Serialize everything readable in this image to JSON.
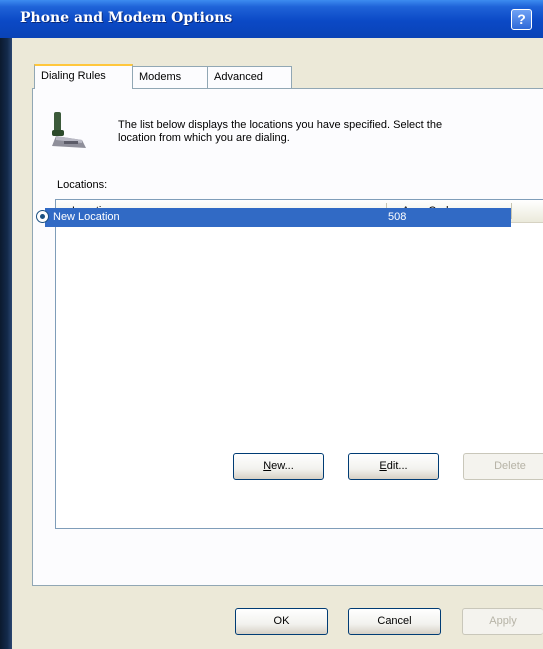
{
  "window": {
    "title": "Phone and Modem Options",
    "help_glyph": "?"
  },
  "tabs": [
    {
      "label": "Dialing Rules",
      "active": true
    },
    {
      "label": "Modems",
      "active": false
    },
    {
      "label": "Advanced",
      "active": false
    }
  ],
  "intro": {
    "line1": "The list below displays the locations you have specified. Select the",
    "line2": "location from which you are dialing."
  },
  "locations": {
    "label": "Locations:",
    "columns": [
      "Location",
      "Area Code"
    ],
    "rows": [
      {
        "name": "New Location",
        "area_code": "508",
        "selected": true
      }
    ]
  },
  "list_buttons": {
    "new": {
      "prefix": "",
      "accel": "N",
      "suffix": "ew..."
    },
    "edit": {
      "prefix": "",
      "accel": "E",
      "suffix": "dit..."
    },
    "delete": {
      "label": "Delete",
      "enabled": false
    }
  },
  "dialog_buttons": {
    "ok": "OK",
    "cancel": "Cancel",
    "apply": {
      "label": "Apply",
      "enabled": false
    }
  },
  "colors": {
    "titlebar": "#0b49c6",
    "selection": "#316ac5",
    "dialog_bg": "#ece9d8",
    "tab_highlight": "#ffc73c"
  },
  "icons": [
    "help-icon",
    "telephone-icon",
    "radio-selected-icon"
  ]
}
